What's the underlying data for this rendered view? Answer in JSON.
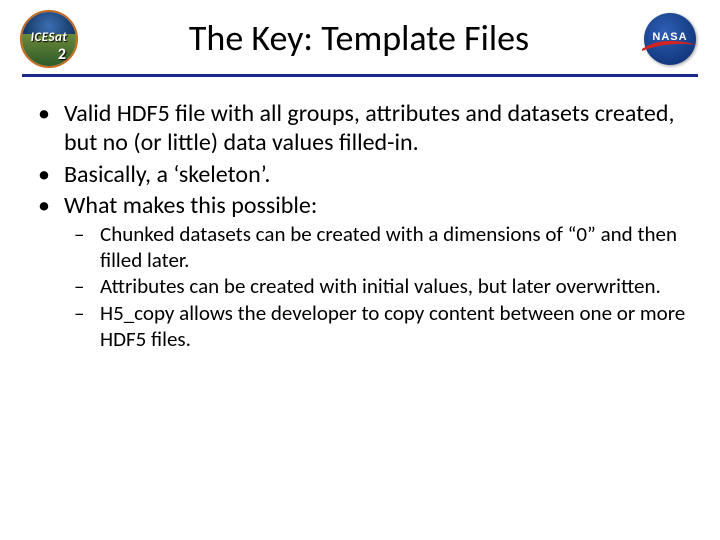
{
  "header": {
    "title": "The Key: Template Files",
    "logo_left": {
      "text": "ICESat",
      "sub": "2"
    },
    "logo_right": {
      "text": "NASA"
    }
  },
  "bullets": [
    "Valid HDF5 file with all groups, attributes and datasets created, but no (or little) data values filled-in.",
    "Basically, a ‘skeleton’.",
    "What makes this possible:"
  ],
  "subbullets": [
    "Chunked datasets can be created with a dimensions of “0” and then filled later.",
    "Attributes can be created with initial values, but later overwritten.",
    "H5_copy allows the developer to copy content between one or more HDF5 files."
  ]
}
